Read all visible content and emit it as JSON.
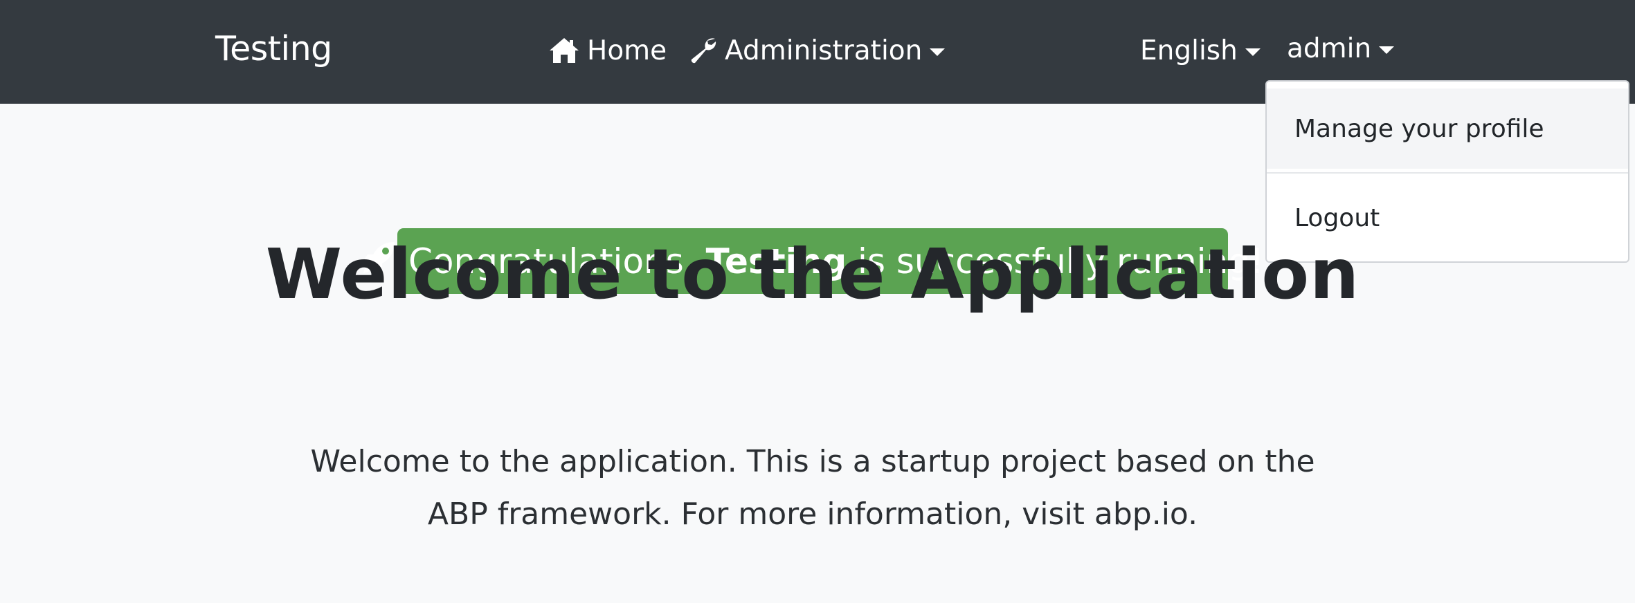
{
  "navbar": {
    "brand": "Testing",
    "home_label": "Home",
    "home_icon": "home-icon",
    "admin_label": "Administration",
    "admin_icon": "wrench-icon",
    "language_label": "English",
    "user_label": "admin",
    "background": "#343a40"
  },
  "user_menu": {
    "items": [
      {
        "label": "Manage your profile"
      },
      {
        "label": "Logout"
      }
    ]
  },
  "banner": {
    "icon": "rocket-icon",
    "prefix": "Congratulations, ",
    "app_name": "Testing",
    "suffix": " is successfully running!",
    "color": "#5ba352"
  },
  "main": {
    "title": "Welcome to the Application",
    "lead_line1": "Welcome to the application. This is a startup project based on the",
    "lead_line2": "ABP framework. For more information, visit abp.io."
  }
}
